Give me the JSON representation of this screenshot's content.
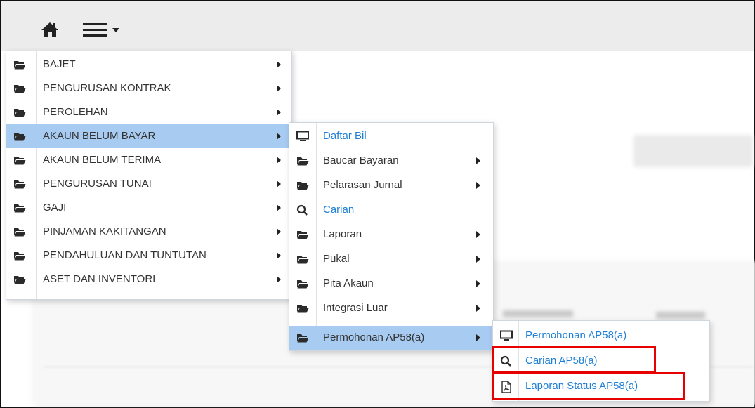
{
  "topbar": {
    "home_icon": "home-icon",
    "menu_icon": "hamburger-menu-icon"
  },
  "menu1": [
    {
      "label": "BAJET",
      "icon": "folder-icon"
    },
    {
      "label": "PENGURUSAN KONTRAK",
      "icon": "folder-icon"
    },
    {
      "label": "PEROLEHAN",
      "icon": "folder-icon"
    },
    {
      "label": "AKAUN BELUM BAYAR",
      "icon": "folder-icon",
      "active": true
    },
    {
      "label": "AKAUN BELUM TERIMA",
      "icon": "folder-icon"
    },
    {
      "label": "PENGURUSAN TUNAI",
      "icon": "folder-icon"
    },
    {
      "label": "GAJI",
      "icon": "folder-icon"
    },
    {
      "label": "PINJAMAN KAKITANGAN",
      "icon": "folder-icon"
    },
    {
      "label": "PENDAHULUAN DAN TUNTUTAN",
      "icon": "folder-icon"
    },
    {
      "label": "ASET DAN INVENTORI",
      "icon": "folder-icon"
    }
  ],
  "menu2": [
    {
      "label": "Daftar Bil",
      "icon": "monitor-icon",
      "link": true
    },
    {
      "label": "Baucar Bayaran",
      "icon": "folder-icon"
    },
    {
      "label": "Pelarasan Jurnal",
      "icon": "folder-icon"
    },
    {
      "label": "Carian",
      "icon": "search-icon",
      "link": true
    },
    {
      "label": "Laporan",
      "icon": "folder-icon"
    },
    {
      "label": "Pukal",
      "icon": "folder-icon"
    },
    {
      "label": "Pita Akaun",
      "icon": "folder-icon"
    },
    {
      "label": "Integrasi Luar",
      "icon": "folder-icon"
    },
    {
      "label": "Permohonan AP58(a)",
      "icon": "folder-icon",
      "active": true
    }
  ],
  "menu3": [
    {
      "label": "Permohonan AP58(a)",
      "icon": "monitor-icon",
      "link": true
    },
    {
      "label": "Carian AP58(a)",
      "icon": "search-icon",
      "link": true
    },
    {
      "label": "Laporan Status AP58(a)",
      "icon": "pdf-file-icon",
      "link": true
    }
  ],
  "colors": {
    "active_bg": "#a8cbf2",
    "link": "#1f7fd6",
    "highlight": "#e60000"
  }
}
